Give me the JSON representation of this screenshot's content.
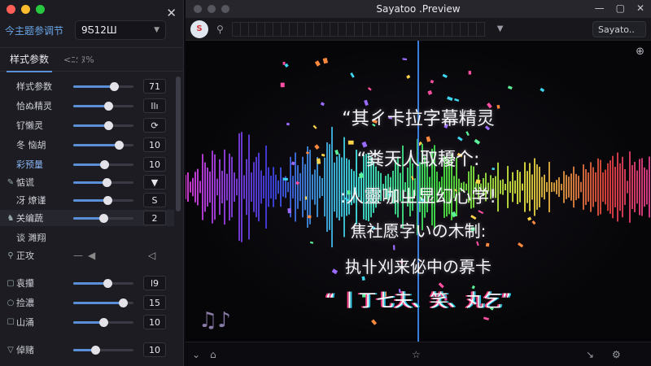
{
  "panel": {
    "title": "今主题参调节",
    "preset_value": "9Ƽ12Ш",
    "tabs": [
      "样式参数",
      "<ﾆ؛ ﾇ%"
    ],
    "params": [
      {
        "label": "样式参数",
        "icon": "",
        "value": "71",
        "level": 0.68,
        "type": "slider"
      },
      {
        "label": "恰ぬ精灵",
        "icon": "",
        "value": "llı",
        "level": 0.58,
        "type": "slider"
      },
      {
        "label": "钌懒灵",
        "icon": "",
        "value": "⟳",
        "level": 0.58,
        "type": "slider"
      },
      {
        "label": "冬 恼胡",
        "icon": "",
        "value": "10",
        "level": 0.75,
        "type": "slider"
      },
      {
        "label": "彩预量",
        "icon": "",
        "value": "10",
        "level": 0.52,
        "type": "slider",
        "highlight": true
      },
      {
        "label": "惦谎",
        "icon": "✎",
        "value": "▼",
        "level": 0.55,
        "type": "slider"
      },
      {
        "label": "冴 燎谨",
        "icon": "",
        "value": "S",
        "level": 0.57,
        "type": "slider"
      },
      {
        "label": "关编蔬",
        "icon": "♞",
        "value": "2",
        "level": 0.5,
        "type": "slider",
        "selected": true
      },
      {
        "label": "谈 濉翔",
        "icon": "",
        "value": "",
        "level": null,
        "type": "label"
      },
      {
        "label": "正攻",
        "icon": "⚲",
        "value": "",
        "level": null,
        "type": "mute"
      },
      {
        "label": "袁攥",
        "icon": "▢",
        "value": "l9",
        "level": 0.57,
        "type": "slider"
      },
      {
        "label": "捡濃",
        "icon": "○",
        "value": "15",
        "level": 0.82,
        "type": "slider"
      },
      {
        "label": "山涌",
        "icon": "☐",
        "value": "10",
        "level": 0.5,
        "type": "slider"
      },
      {
        "label": "倬赌",
        "icon": "▽",
        "value": "10",
        "level": 0.37,
        "type": "slider"
      }
    ]
  },
  "preview": {
    "title": "Sayatoo .Preview",
    "logo": "S",
    "source_select": "Sayato..",
    "window_buttons": [
      "—",
      "▢",
      "✕"
    ],
    "lyrics": [
      "“其ㄔ卡拉字幕精灵",
      "“粪天人取耰个:",
      ":人靈咖ㄓ显幻心学!",
      "焦社愿字いの木制:",
      "执卝刈来佖中の奡卡",
      "“ 丨丁七夫、笑、丸乞”"
    ]
  },
  "colors": {
    "accent": "#5a8fd8",
    "panel_title": "#6aa7e8",
    "playhead": "#3a7ee0"
  }
}
